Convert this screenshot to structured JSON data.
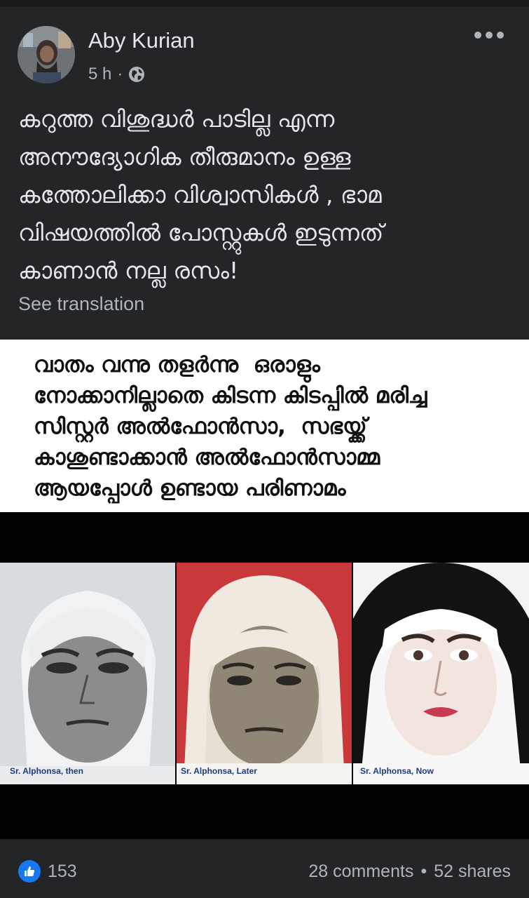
{
  "post": {
    "author": "Aby Kurian",
    "time": "5 h",
    "separator": "·",
    "text": "കറുത്ത വിശുദ്ധർ പാടില്ല എന്ന\nഅനൗദ്യോഗിക തീരുമാനം ഉള്ള\nകത്തോലിക്കാ വിശ്വാസികൾ , ഭാമ\nവിഷയത്തിൽ പോസ്റ്റുകൾ ഇടുന്നത്\nകാണാൻ നല്ല രസം!",
    "see_translation": "See translation"
  },
  "image": {
    "quote": "വാതം വന്നു തളർന്നു  ഒരാളും\nനോക്കാനില്ലാതെ കിടന്ന കിടപ്പിൽ മരിച്ച\nസിസ്റ്റർ അൽഫോൻസാ,  സഭയ്ക്ക്\nകാശുണ്ടാക്കാൻ അൽഫോൻസാമ്മ\nആയപ്പോൾ ഉണ്ടായ പരിണാമം",
    "captions": [
      "Sr. Alphonsa, then",
      "Sr. Alphonsa, Later",
      "Sr. Alphonsa, Now"
    ]
  },
  "footer": {
    "reaction_count": "153",
    "comments": "28 comments",
    "dot": "•",
    "shares": "52 shares"
  },
  "icons": {
    "globe": "globe-icon",
    "more": "more-options-icon",
    "like": "like-icon"
  },
  "colors": {
    "background": "#242526",
    "like_blue": "#1877f2",
    "secondary_text": "#b0b3b8"
  }
}
